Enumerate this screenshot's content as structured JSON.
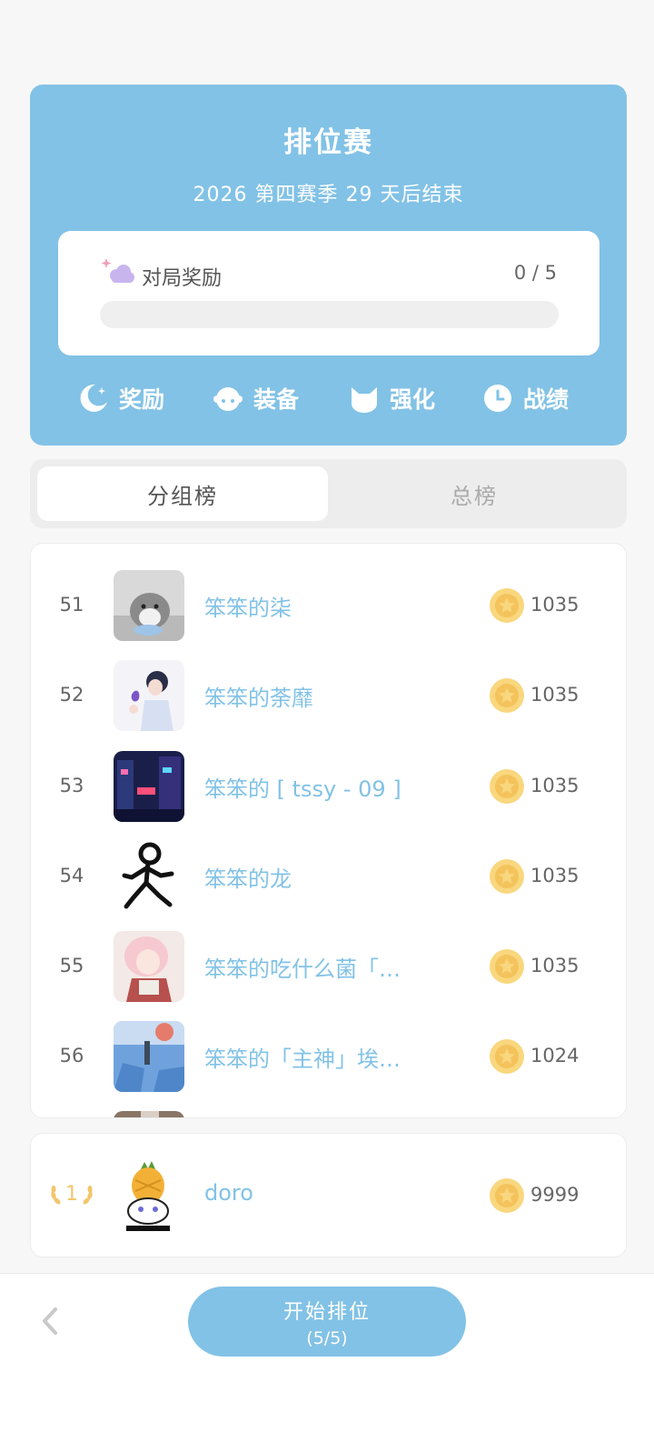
{
  "hero": {
    "title": "排位赛",
    "subtitle": "2026 第四赛季 29 天后结束",
    "reward": {
      "label": "对局奖励",
      "count": "0 / 5",
      "progress": 0
    },
    "actions": [
      {
        "label": "奖励",
        "icon": "moon-icon"
      },
      {
        "label": "装备",
        "icon": "bear-icon"
      },
      {
        "label": "强化",
        "icon": "cat-icon"
      },
      {
        "label": "战绩",
        "icon": "clock-icon"
      }
    ]
  },
  "tabs": {
    "group": "分组榜",
    "total": "总榜"
  },
  "leaderboard": [
    {
      "rank": "51",
      "name": "笨笨的柒",
      "score": "1035"
    },
    {
      "rank": "52",
      "name": "笨笨的荼靡",
      "score": "1035"
    },
    {
      "rank": "53",
      "name": "笨笨的 [ tssy - 09 ]",
      "score": "1035"
    },
    {
      "rank": "54",
      "name": "笨笨的龙",
      "score": "1035"
    },
    {
      "rank": "55",
      "name": "笨笨的吃什么菌「…",
      "score": "1035"
    },
    {
      "rank": "56",
      "name": "笨笨的「主神」埃…",
      "score": "1024"
    }
  ],
  "self": {
    "rank": "1",
    "name": "doro",
    "score": "9999"
  },
  "bottom": {
    "start_label": "开始排位",
    "start_count": "(5/5)"
  },
  "colors": {
    "accent": "#82c2e6",
    "coin": "#f9d77e",
    "background": "#f7f7f7"
  }
}
